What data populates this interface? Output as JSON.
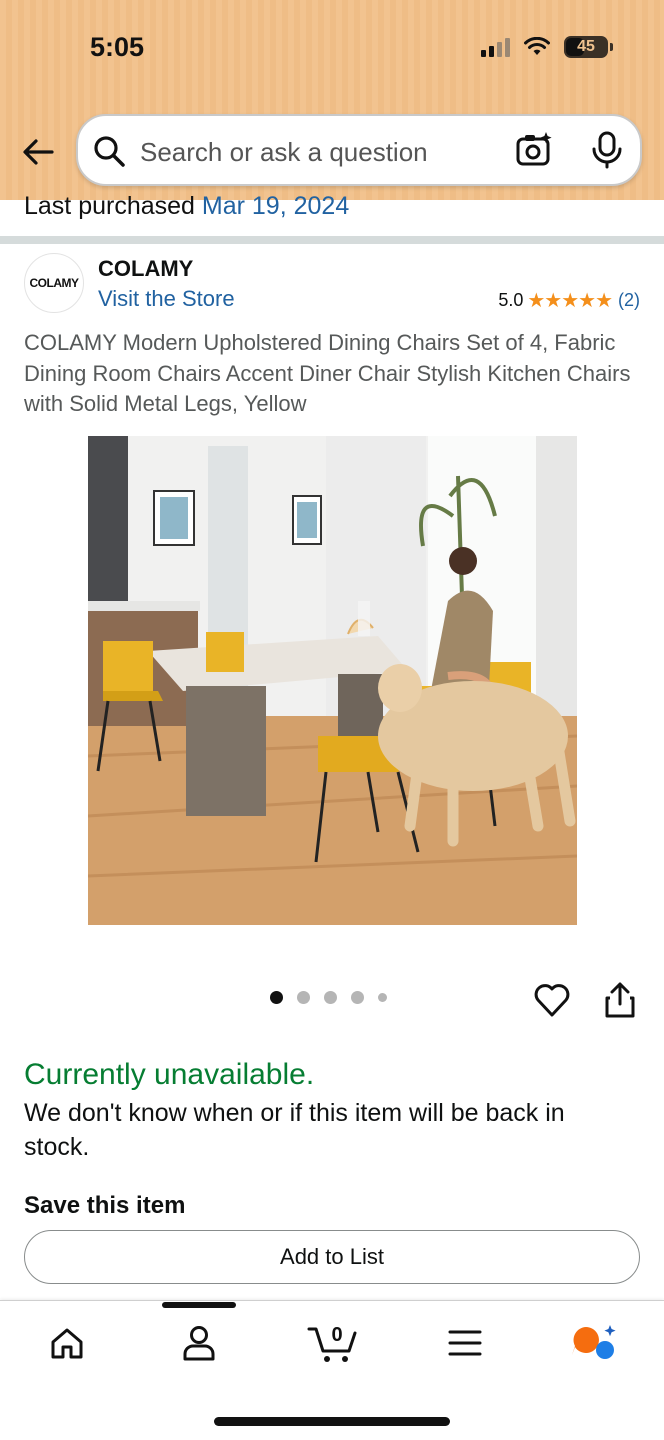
{
  "status_bar": {
    "time": "5:05",
    "battery": "45"
  },
  "search": {
    "placeholder": "Search or ask a question"
  },
  "last_purchased": {
    "label": "Last purchased",
    "date": "Mar 19, 2024"
  },
  "brand": {
    "logo_text": "COLAMY",
    "name": "COLAMY",
    "store_link": "Visit the Store"
  },
  "rating": {
    "score": "5.0",
    "stars": "★★★★★",
    "count": "(2)"
  },
  "product": {
    "title": "COLAMY Modern Upholstered Dining Chairs Set of 4, Fabric Dining Room Chairs Accent Diner Chair Stylish Kitchen Chairs with Solid Metal Legs, Yellow"
  },
  "gallery": {
    "image_count": 5,
    "active_index": 0
  },
  "availability": {
    "status": "Currently unavailable.",
    "message": "We don't know when or if this item will be back in stock."
  },
  "save": {
    "heading": "Save this item",
    "button": "Add to List"
  },
  "bottom_nav": {
    "items": [
      "home-icon",
      "profile-icon",
      "cart-icon",
      "menu-icon",
      "rufus-icon"
    ],
    "cart_count": "0"
  },
  "colors": {
    "header": "#f2c38f",
    "link": "#2162a1",
    "unavailable": "#067d32",
    "stars": "#f48f1b"
  }
}
